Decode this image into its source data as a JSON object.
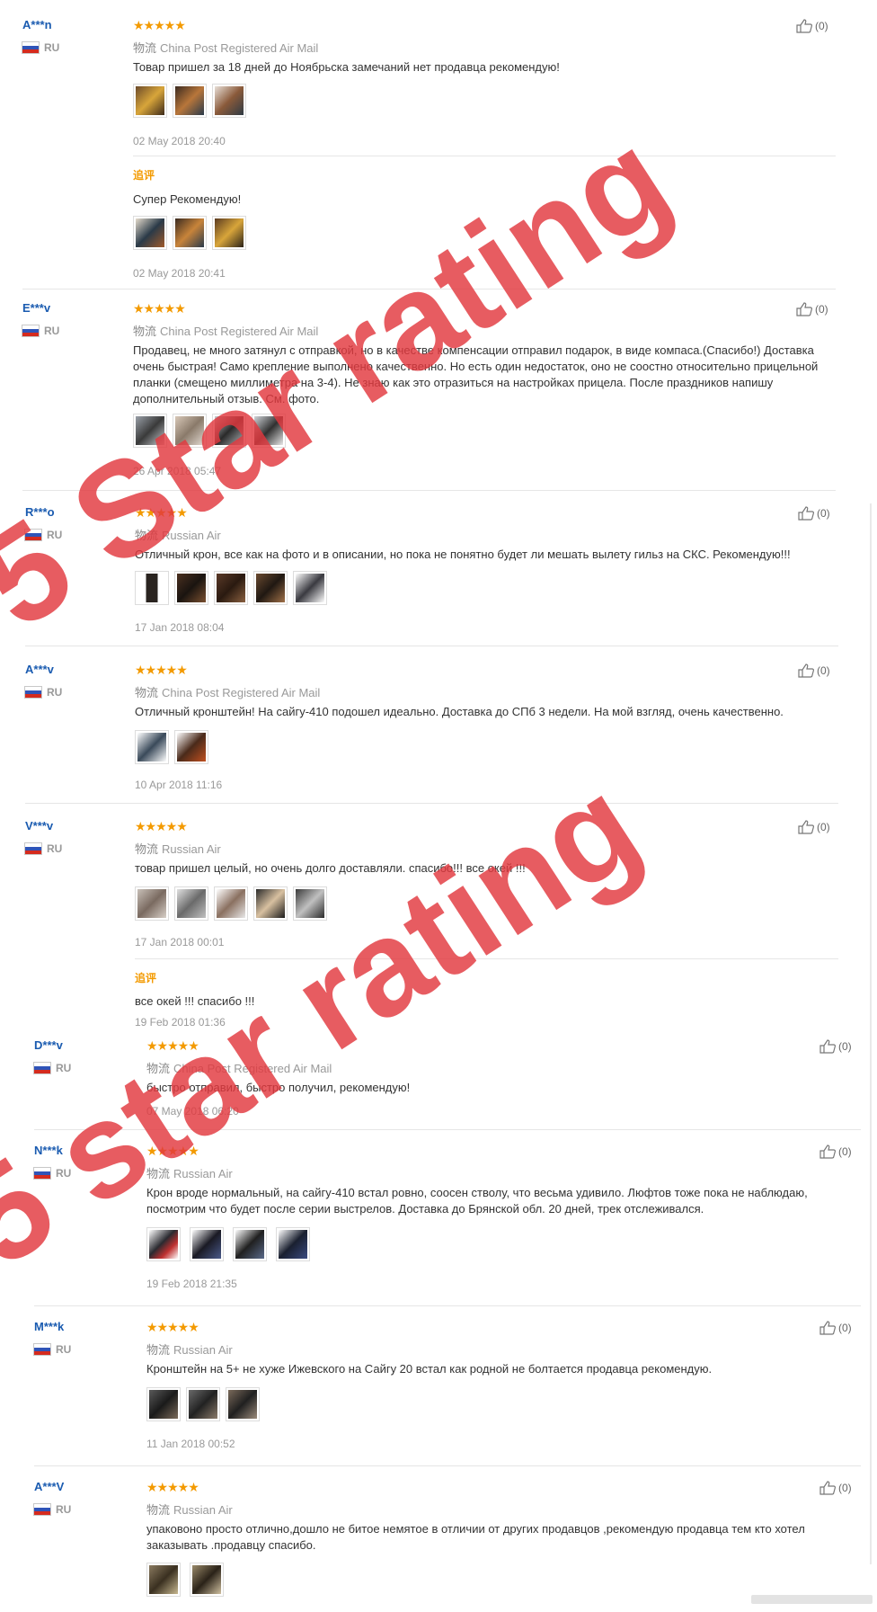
{
  "reviews": [
    {
      "user": "A***n",
      "country": "RU",
      "stars": "★★★★★",
      "shipping_cn": "物流",
      "shipping": "China Post Registered Air Mail",
      "text": "Товар пришел за 18 дней до Ноябрьска замечаний нет продавца рекомендую!",
      "date": "02 May 2018 20:40",
      "likes": "(0)",
      "additional": {
        "label": "追评",
        "text": "Супер Рекомендую!",
        "date": "02 May 2018 20:41"
      }
    },
    {
      "user": "E***v",
      "country": "RU",
      "stars": "★★★★★",
      "shipping_cn": "物流",
      "shipping": "China Post Registered Air Mail",
      "text": "Продавец, не много затянул с отправкой, но в качестве компенсации отправил подарок, в виде компаса.(Спасибо!) Доставка очень быстрая! Само крепление выполнено качественно. Но есть один недостаток, оно не соостно относительно прицельной планки (смещено миллиметра на 3-4). Не знаю как это отразиться на настройках прицела. После праздников напишу дополнительный отзыв. См. фото.",
      "date": "26 Apr 2018 05:47",
      "likes": "(0)"
    },
    {
      "user": "R***o",
      "country": "RU",
      "stars": "★★★★★",
      "shipping_cn": "物流",
      "shipping": "Russian Air",
      "text": "Отличный крон, все как на фото и в описании, но пока не понятно будет ли мешать вылету гильз на СКС. Рекомендую!!!",
      "date": "17 Jan 2018 08:04",
      "likes": "(0)"
    },
    {
      "user": "A***v",
      "country": "RU",
      "stars": "★★★★★",
      "shipping_cn": "物流",
      "shipping": "China Post Registered Air Mail",
      "text": "Отличный кронштейн! На сайгу-410 подошел идеально. Доставка до СПб 3 недели. На мой взгляд, очень качественно.",
      "date": "10 Apr 2018 11:16",
      "likes": "(0)"
    },
    {
      "user": "V***v",
      "country": "RU",
      "stars": "★★★★★",
      "shipping_cn": "物流",
      "shipping": "Russian Air",
      "text": "товар пришел целый, но очень долго доставляли. спасибо!!! все окей !!!",
      "date": "17 Jan 2018 00:01",
      "likes": "(0)",
      "additional": {
        "label": "追评",
        "text": "все окей !!! спасибо !!!",
        "date": "19 Feb 2018 01:36"
      }
    },
    {
      "user": "D***v",
      "country": "RU",
      "stars": "★★★★★",
      "shipping_cn": "物流",
      "shipping": "China Post Registered Air Mail",
      "text": "быстро отправил, быстро получил, рекомендую!",
      "date": "07 May 2018 06:20",
      "likes": "(0)"
    },
    {
      "user": "N***k",
      "country": "RU",
      "stars": "★★★★★",
      "shipping_cn": "物流",
      "shipping": "Russian Air",
      "text": "Крон вроде нормальный, на сайгу-410 встал ровно, соосен стволу, что весьма удивило. Люфтов тоже пока не наблюдаю, посмотрим что будет после серии выстрелов. Доставка до Брянской обл. 20 дней, трек отслеживался.",
      "date": "19 Feb 2018 21:35",
      "likes": "(0)"
    },
    {
      "user": "M***k",
      "country": "RU",
      "stars": "★★★★★",
      "shipping_cn": "物流",
      "shipping": "Russian Air",
      "text": "Кронштейн на 5+ не хуже Ижевского на Сайгу 20 встал как родной не болтается продавца рекомендую.",
      "date": "11 Jan 2018 00:52",
      "likes": "(0)"
    },
    {
      "user": "A***V",
      "country": "RU",
      "stars": "★★★★★",
      "shipping_cn": "物流",
      "shipping": "Russian Air",
      "text": "упаковоно просто отлично,дошло не битое немятое в отличии от других продавцов ,рекомендую продавца тем кто хотел заказывать .продавцу спасибо.",
      "likes": "(0)"
    }
  ],
  "watermarks": [
    "5 Star rating",
    "5 star rating"
  ],
  "colors": {
    "star": "#f39a00",
    "username": "#1a5bb0",
    "watermark": "#e2383e"
  }
}
